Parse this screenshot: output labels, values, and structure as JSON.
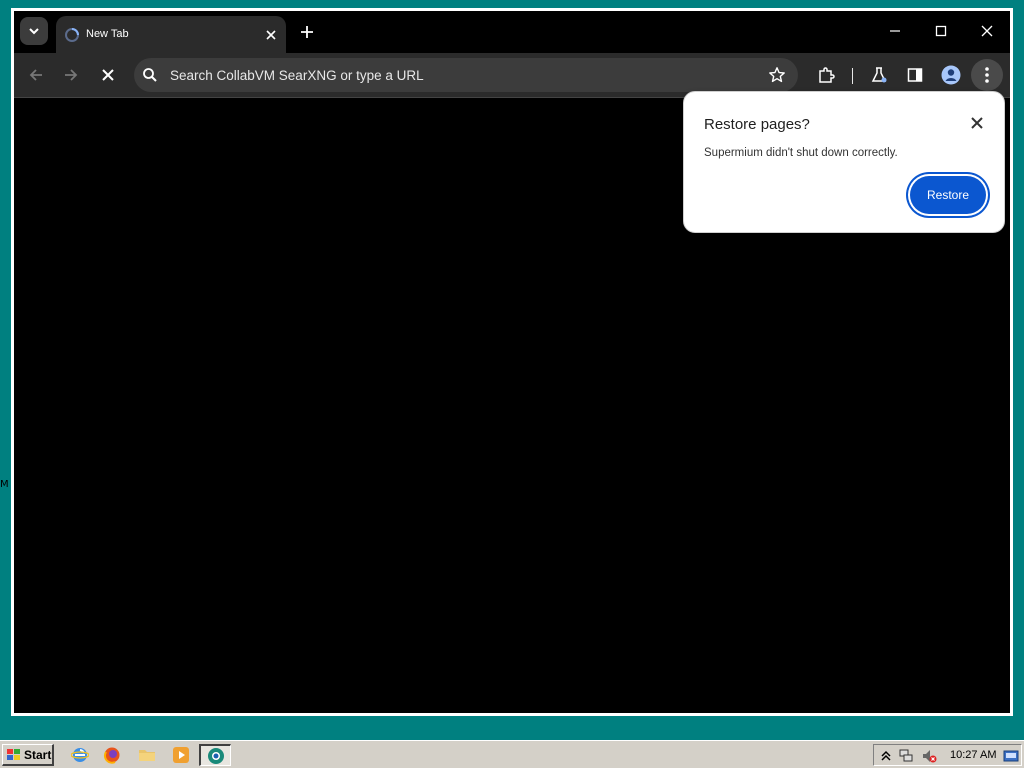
{
  "desktop": {
    "stray_text": "M",
    "background_color": "#008080"
  },
  "browser": {
    "tab": {
      "title": "New Tab",
      "favicon": "loading-spinner-icon"
    },
    "omnibox": {
      "placeholder": "Search CollabVM SearXNG or type a URL"
    },
    "toolbar_icons": [
      "back-icon",
      "forward-icon",
      "stop-loading-icon",
      "bookmark-star-icon",
      "extensions-icon",
      "labs-icon",
      "side-panel-icon",
      "profile-icon",
      "menu-icon"
    ],
    "window_controls": [
      "minimize-icon",
      "maximize-icon",
      "close-icon"
    ]
  },
  "dialog": {
    "title": "Restore pages?",
    "message": "Supermium didn't shut down correctly.",
    "restore_label": "Restore",
    "accent_color": "#0b57d0"
  },
  "taskbar": {
    "start_label": "Start",
    "quick_launch": [
      "internet-explorer-icon",
      "firefox-icon",
      "folder-icon",
      "media-player-icon"
    ],
    "active_task_icon": "supermium-icon",
    "tray_icons": [
      "tray-expand-icon",
      "network-icon",
      "volume-muted-icon",
      "keyboard-icon"
    ],
    "clock": "10:27 AM"
  }
}
